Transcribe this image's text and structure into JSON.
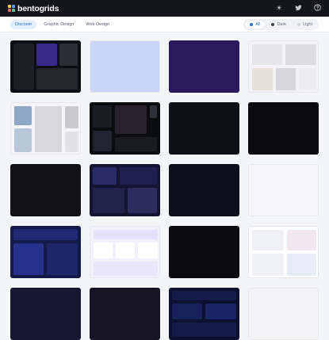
{
  "app": {
    "name": "bentogrids",
    "logo_colors": [
      "#f7c948",
      "#4f9cf9",
      "#ef6a6a",
      "#5cc98f"
    ]
  },
  "header": {
    "icons": [
      "sun-icon",
      "twitter-icon",
      "help-icon"
    ]
  },
  "filters": {
    "tabs": [
      {
        "label": "Discover",
        "active": true
      },
      {
        "label": "Graphic Design",
        "active": false
      },
      {
        "label": "Web Design",
        "active": false
      }
    ],
    "themes": [
      {
        "label": "All",
        "active": true,
        "dot": "#2b6fd6"
      },
      {
        "label": "Dark",
        "active": false,
        "dot": "#3b3f4a"
      },
      {
        "label": "Light",
        "active": false,
        "dot": "#d4d6dd"
      }
    ]
  },
  "colors": {
    "accent": "#2b6fd6",
    "topbar": "#15161c"
  },
  "grid": {
    "cards": [
      {
        "bg": "#0e0f14",
        "theme": "dark",
        "preview": "app-showcase-mixed"
      },
      {
        "bg": "#c8d5f6",
        "theme": "light",
        "preview": "blank-pastel-blue"
      },
      {
        "bg": "#2a1a5e",
        "theme": "dark",
        "preview": "blank-deep-purple"
      },
      {
        "bg": "#f3f3f5",
        "theme": "light",
        "preview": "watch-showcase"
      },
      {
        "bg": "#f5f5f7",
        "theme": "light",
        "preview": "phone-camera-showcase"
      },
      {
        "bg": "#0b0c10",
        "theme": "dark",
        "preview": "headset-feature-grid"
      },
      {
        "bg": "#101118",
        "theme": "dark",
        "preview": "blank-dark"
      },
      {
        "bg": "#0b0b0e",
        "theme": "dark",
        "preview": "blank-black"
      },
      {
        "bg": "#121216",
        "theme": "dark",
        "preview": "blank-dark"
      },
      {
        "bg": "#141533",
        "theme": "dark",
        "preview": "ai-dashboard-grid"
      },
      {
        "bg": "#0f0f1c",
        "theme": "dark",
        "preview": "blank-navy"
      },
      {
        "bg": "#f6f6f8",
        "theme": "light",
        "preview": "blank-white"
      },
      {
        "bg": "#141a48",
        "theme": "dark",
        "preview": "blue-dashboard"
      },
      {
        "bg": "#f1f0fb",
        "theme": "light",
        "preview": "workflow-grid"
      },
      {
        "bg": "#0c0c0e",
        "theme": "dark",
        "preview": "blank-black"
      },
      {
        "bg": "#ffffff",
        "theme": "light",
        "preview": "laptop-product-grid"
      },
      {
        "bg": "#181630",
        "theme": "dark",
        "preview": "blank-dark-indigo"
      },
      {
        "bg": "#161425",
        "theme": "dark",
        "preview": "blank-dark-indigo"
      },
      {
        "bg": "#0c1130",
        "theme": "dark",
        "preview": "security-feature-grid"
      },
      {
        "bg": "#f3f3f5",
        "theme": "light",
        "preview": "blank-light"
      }
    ]
  }
}
